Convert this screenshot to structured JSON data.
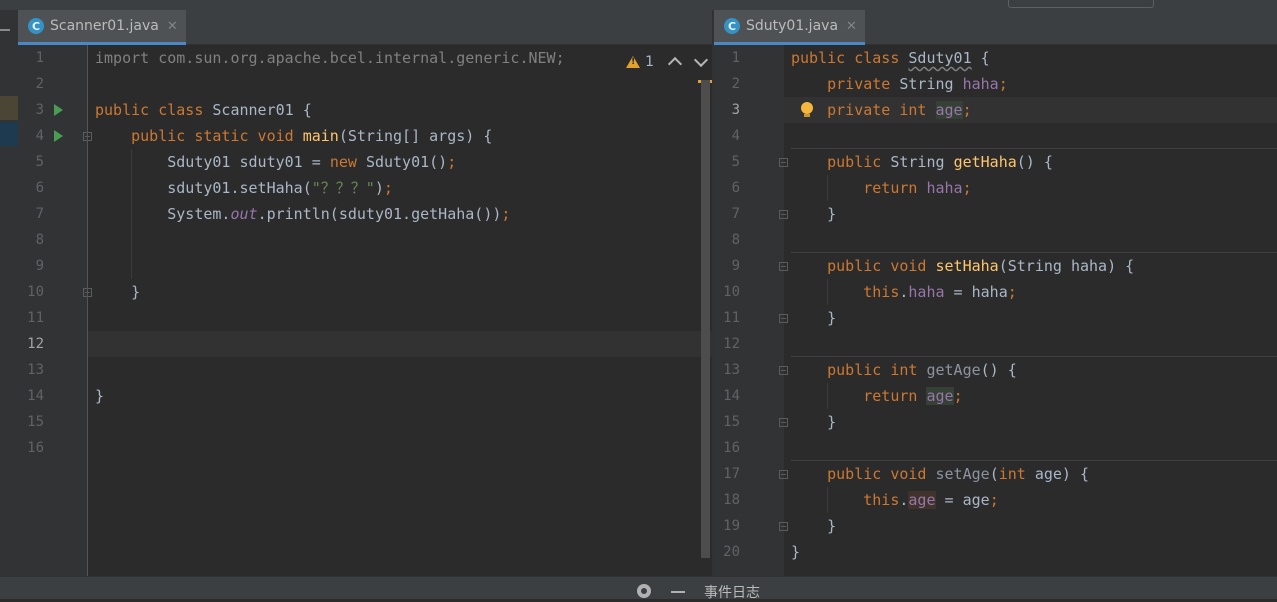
{
  "left_editor": {
    "tab": {
      "label": "Scanner01.java",
      "icon": "c-class-icon"
    },
    "inspection": {
      "warning_count": "1"
    },
    "lines": [
      {
        "n": "1",
        "tokens": [
          [
            "gray",
            "import com.sun.org.apache.bcel.internal.generic.NEW;"
          ]
        ]
      },
      {
        "n": "2",
        "tokens": []
      },
      {
        "n": "3",
        "tokens": [
          [
            "kw",
            "public class "
          ],
          [
            "",
            "Scanner01 {"
          ]
        ]
      },
      {
        "n": "4",
        "tokens": [
          [
            "",
            "    "
          ],
          [
            "kw",
            "public static void "
          ],
          [
            "fn",
            "main"
          ],
          [
            "",
            "(String[] args) {"
          ]
        ]
      },
      {
        "n": "5",
        "tokens": [
          [
            "",
            "        Sduty01 sduty01 = "
          ],
          [
            "kw",
            "new "
          ],
          [
            "",
            "Sduty01()"
          ],
          [
            "kw",
            ";"
          ]
        ]
      },
      {
        "n": "6",
        "tokens": [
          [
            "",
            "        sduty01.setHaha("
          ],
          [
            "str",
            "\"？？？\""
          ],
          [
            "",
            ")"
          ],
          [
            "kw",
            ";"
          ]
        ]
      },
      {
        "n": "7",
        "tokens": [
          [
            "",
            "        System."
          ],
          [
            "sf",
            "out"
          ],
          [
            "",
            ".println(sduty01.getHaha())"
          ],
          [
            "kw",
            ";"
          ]
        ]
      },
      {
        "n": "8",
        "tokens": []
      },
      {
        "n": "9",
        "tokens": []
      },
      {
        "n": "10",
        "tokens": [
          [
            "",
            "    }"
          ]
        ]
      },
      {
        "n": "11",
        "tokens": []
      },
      {
        "n": "12",
        "tokens": []
      },
      {
        "n": "13",
        "tokens": []
      },
      {
        "n": "14",
        "tokens": [
          [
            "",
            "}"
          ]
        ]
      },
      {
        "n": "15",
        "tokens": []
      },
      {
        "n": "16",
        "tokens": []
      }
    ]
  },
  "right_editor": {
    "tab": {
      "label": "Sduty01.java",
      "icon": "c-class-icon"
    },
    "lines": [
      {
        "n": "1",
        "tokens": [
          [
            "kw",
            "public class "
          ],
          [
            "squig",
            "Sduty01"
          ],
          [
            "",
            " {"
          ]
        ]
      },
      {
        "n": "2",
        "tokens": [
          [
            "",
            "    "
          ],
          [
            "kw",
            "private "
          ],
          [
            "",
            "String "
          ],
          [
            "fld",
            "haha"
          ],
          [
            "kw",
            ";"
          ]
        ]
      },
      {
        "n": "3",
        "tokens": [
          [
            "",
            "    "
          ],
          [
            "kw",
            "private int "
          ],
          [
            "fldhl",
            "age"
          ],
          [
            "kw",
            ";"
          ]
        ]
      },
      {
        "n": "4",
        "tokens": []
      },
      {
        "n": "5",
        "tokens": [
          [
            "",
            "    "
          ],
          [
            "kw",
            "public "
          ],
          [
            "",
            "String "
          ],
          [
            "fn",
            "getHaha"
          ],
          [
            "",
            "() {"
          ]
        ]
      },
      {
        "n": "6",
        "tokens": [
          [
            "",
            "        "
          ],
          [
            "kw",
            "return "
          ],
          [
            "fld",
            "haha"
          ],
          [
            "kw",
            ";"
          ]
        ]
      },
      {
        "n": "7",
        "tokens": [
          [
            "",
            "    }"
          ]
        ]
      },
      {
        "n": "8",
        "tokens": []
      },
      {
        "n": "9",
        "tokens": [
          [
            "",
            "    "
          ],
          [
            "kw",
            "public void "
          ],
          [
            "fn",
            "setHaha"
          ],
          [
            "",
            "(String haha) {"
          ]
        ]
      },
      {
        "n": "10",
        "tokens": [
          [
            "",
            "        "
          ],
          [
            "kw",
            "this"
          ],
          [
            "",
            "."
          ],
          [
            "fld",
            "haha"
          ],
          [
            "",
            " = haha"
          ],
          [
            "kw",
            ";"
          ]
        ]
      },
      {
        "n": "11",
        "tokens": [
          [
            "",
            "    }"
          ]
        ]
      },
      {
        "n": "12",
        "tokens": []
      },
      {
        "n": "13",
        "tokens": [
          [
            "",
            "    "
          ],
          [
            "kw",
            "public int "
          ],
          [
            "dim",
            "getAge"
          ],
          [
            "",
            "() {"
          ]
        ]
      },
      {
        "n": "14",
        "tokens": [
          [
            "",
            "        "
          ],
          [
            "kw",
            "return "
          ],
          [
            "fldhl",
            "age"
          ],
          [
            "kw",
            ";"
          ]
        ]
      },
      {
        "n": "15",
        "tokens": [
          [
            "",
            "    }"
          ]
        ]
      },
      {
        "n": "16",
        "tokens": []
      },
      {
        "n": "17",
        "tokens": [
          [
            "",
            "    "
          ],
          [
            "kw",
            "public void "
          ],
          [
            "dim",
            "setAge"
          ],
          [
            "",
            "("
          ],
          [
            "kw",
            "int "
          ],
          [
            "",
            "age) {"
          ]
        ]
      },
      {
        "n": "18",
        "tokens": [
          [
            "",
            "        "
          ],
          [
            "kw",
            "this"
          ],
          [
            "",
            "."
          ],
          [
            "fldhl2",
            "age"
          ],
          [
            "",
            " = age"
          ],
          [
            "kw",
            ";"
          ]
        ]
      },
      {
        "n": "19",
        "tokens": [
          [
            "",
            "    }"
          ]
        ]
      },
      {
        "n": "20",
        "tokens": [
          [
            "",
            "}"
          ]
        ]
      }
    ]
  },
  "statusbar": {
    "settings_icon": "gear-icon",
    "hide_icon": "minus-icon",
    "event_log_label": "事件日志"
  },
  "colors": {
    "keyword": "#cc7832",
    "method": "#ffc66d",
    "field": "#9876aa",
    "string": "#6a8759",
    "text": "#a9b7c6",
    "background": "#2b2b2b",
    "gutter": "#313335",
    "warning": "#e2a12d"
  }
}
